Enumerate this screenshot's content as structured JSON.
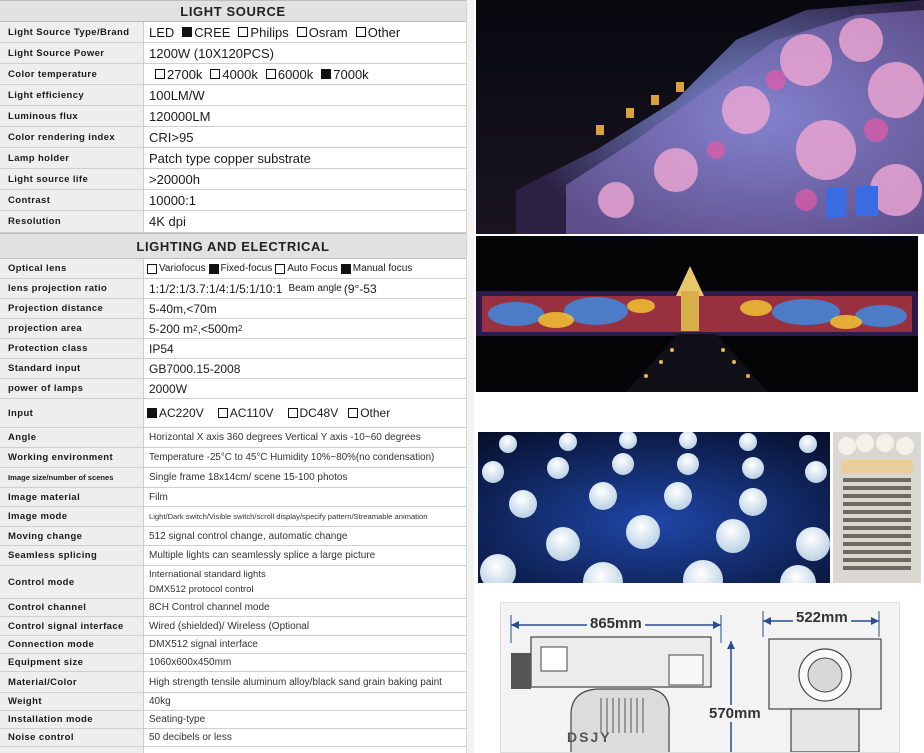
{
  "sections": {
    "light_source": "LIGHT SOURCE",
    "lighting_electrical": "LIGHTING AND ELECTRICAL"
  },
  "specs": {
    "light_source_type": {
      "label": "Light Source Type/Brand",
      "options": [
        {
          "text": "LED",
          "checked": null
        },
        {
          "text": "CREE",
          "checked": true
        },
        {
          "text": "Philips",
          "checked": false
        },
        {
          "text": "Osram",
          "checked": false
        },
        {
          "text": "Other",
          "checked": false
        }
      ]
    },
    "light_source_power": {
      "label": "Light Source Power",
      "value": "1200W (10X120PCS)"
    },
    "color_temperature": {
      "label": "Color temperature",
      "options": [
        {
          "text": "2700k",
          "checked": false
        },
        {
          "text": "4000k",
          "checked": false
        },
        {
          "text": "6000k",
          "checked": false
        },
        {
          "text": "7000k",
          "checked": true
        }
      ]
    },
    "light_efficiency": {
      "label": "Light efficiency",
      "value": "100LM/W"
    },
    "luminous_flux": {
      "label": "Luminous flux",
      "value": "120000LM"
    },
    "cri": {
      "label": "Color rendering index",
      "value": "CRI>95"
    },
    "lamp_holder": {
      "label": "Lamp holder",
      "value": "Patch type copper substrate"
    },
    "light_source_life": {
      "label": "Light source life",
      "value": ">20000h"
    },
    "contrast": {
      "label": "Contrast",
      "value": "10000:1"
    },
    "resolution": {
      "label": "Resolution",
      "value": "4K dpi"
    },
    "optical_lens": {
      "label": "Optical lens",
      "options": [
        {
          "text": "Variofocus",
          "checked": false
        },
        {
          "text": "Fixed-focus",
          "checked": true
        },
        {
          "text": "Auto Focus",
          "checked": false
        },
        {
          "text": "Manual focus",
          "checked": true
        }
      ]
    },
    "lens_projection_ratio": {
      "label": "lens projection ratio",
      "value": "1:1/2:1/3.7:1/4:1/5:1/10:1",
      "beam_label": "Beam angle",
      "beam_value": "(9°-53"
    },
    "projection_distance": {
      "label": "Projection distance",
      "value": "5-40m,<70m"
    },
    "projection_area": {
      "label": "projection area",
      "value_a": "5-200 m",
      "sup_a": "2",
      "value_b": ",<500m",
      "sup_b": "2"
    },
    "protection_class": {
      "label": "Protection class",
      "value": "IP54"
    },
    "standard_input": {
      "label": "Standard input",
      "value": "GB7000.15-2008"
    },
    "power_of_lamps": {
      "label": "power of lamps",
      "value": "2000W"
    },
    "input": {
      "label": "Input",
      "options": [
        {
          "text": "AC220V",
          "checked": true
        },
        {
          "text": "AC110V",
          "checked": false
        },
        {
          "text": "DC48V",
          "checked": false
        },
        {
          "text": "Other",
          "checked": false
        }
      ]
    },
    "angle": {
      "label": "Angle",
      "value": "Horizontal X axis 360 degrees Vertical Y axis -10~60 degrees"
    },
    "working_environment": {
      "label": "Working environment",
      "value": "Temperature -25°C to 45°C  Humidity 10%~80%(no condensation)"
    },
    "image_size": {
      "label": "Image size/number of scenes",
      "value": "Single frame 18x14cm/ scene 15-100 photos"
    },
    "image_material": {
      "label": "Image material",
      "value": "Film"
    },
    "image_mode": {
      "label": "Image mode",
      "value": "Light/Dark switch/Visible switch/scroll display/specify pattern/Streamable animation"
    },
    "moving_change": {
      "label": "Moving change",
      "value": "512 signal control change, automatic change"
    },
    "seamless_splicing": {
      "label": "Seamless splicing",
      "value": "Multiple lights can seamlessly splice a large picture"
    },
    "control_mode": {
      "label": "Control mode",
      "line1": "International standard lights",
      "line2": "DMX512 protocol control"
    },
    "control_channel": {
      "label": "Control channel",
      "value": "8CH Control channel mode"
    },
    "control_signal_interface": {
      "label": "Control signal interface",
      "value": "Wired (shielded)/ Wireless (Optional"
    },
    "connection_mode": {
      "label": "Connection mode",
      "value": "DMX512 signal interface"
    },
    "equipment_size": {
      "label": "Equipment size",
      "value": "1060x600x450mm"
    },
    "material_color": {
      "label": "Material/Color",
      "value": "High strength tensile aluminum alloy/black sand grain baking paint"
    },
    "weight": {
      "label": "Weight",
      "value": "40kg"
    },
    "installation_mode": {
      "label": "Installation mode",
      "value": "Seating-type"
    },
    "noise_control": {
      "label": "Noise control",
      "value": "50 decibels or less"
    }
  },
  "dimensions": {
    "width_label": "865mm",
    "depth_label": "522mm",
    "height_label": "570mm",
    "brand_mark": "DSJY"
  },
  "colors": {
    "header_bg": "#e2e2e2",
    "label_bg": "#eeeeee",
    "border": "#cfcfcf",
    "dim_line": "#2a4d8f"
  }
}
